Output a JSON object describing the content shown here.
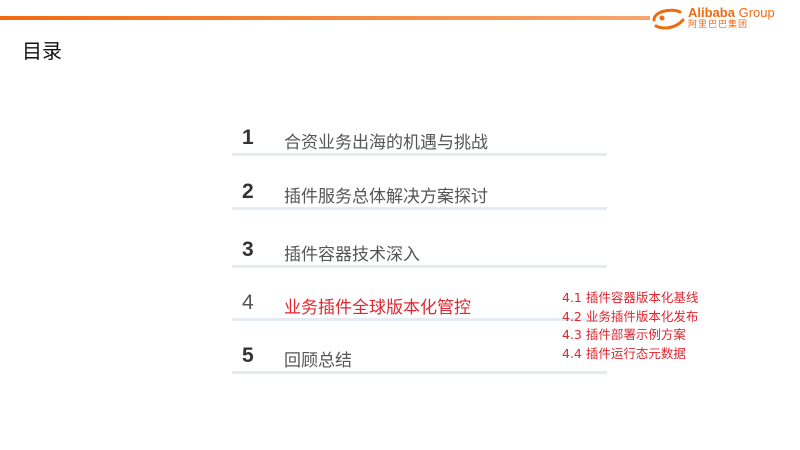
{
  "header": {
    "logo_en_bold": "Alibaba",
    "logo_en_rest": " Group",
    "logo_cn": "阿里巴巴集团",
    "accent_color": "#f26a10"
  },
  "page": {
    "title": "目录"
  },
  "toc": {
    "items": [
      {
        "number": "1",
        "label": "合资业务出海的机遇与挑战"
      },
      {
        "number": "2",
        "label": "插件服务总体解决方案探讨"
      },
      {
        "number": "3",
        "label": "插件容器技术深入"
      },
      {
        "number": "4",
        "label": "业务插件全球版本化管控",
        "active": true
      },
      {
        "number": "5",
        "label": "回顾总结"
      }
    ],
    "active_color": "#e0262f"
  },
  "subsections": [
    "4.1 插件容器版本化基线",
    "4.2 业务插件版本化发布",
    "4.3 插件部署示例方案",
    "4.4 插件运行态元数据"
  ]
}
